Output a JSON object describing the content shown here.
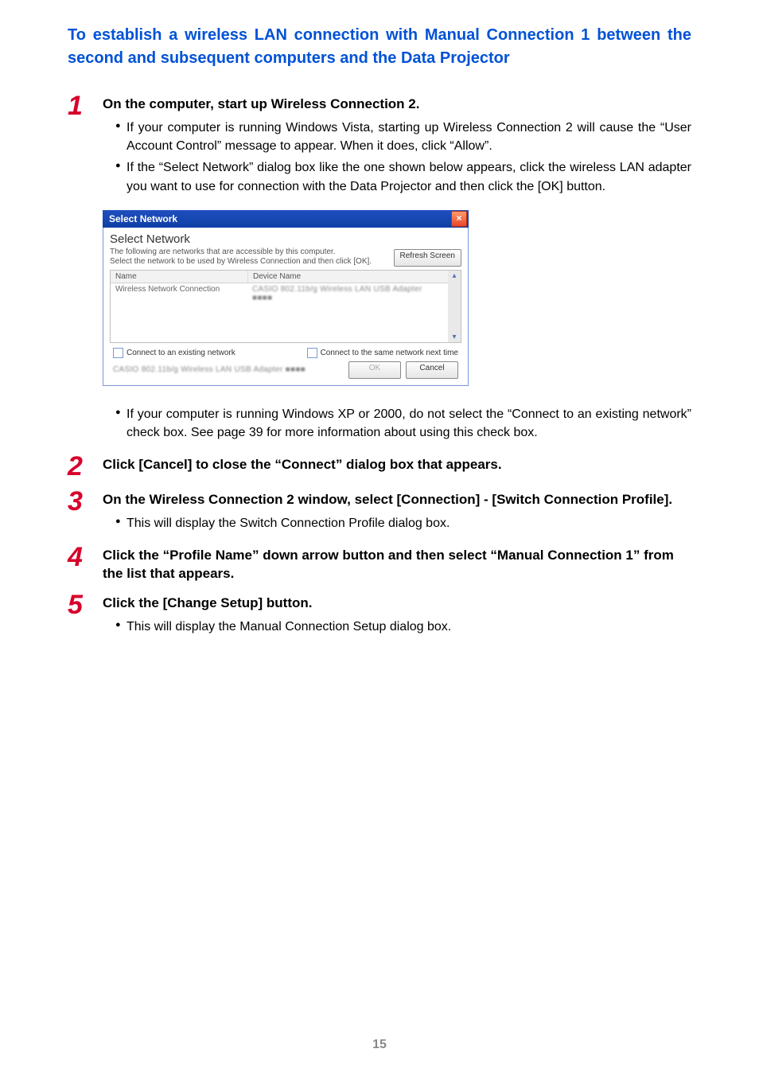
{
  "heading": "To establish a wireless LAN connection with Manual Connection 1 between the second and subsequent computers and the Data Projector",
  "steps": [
    {
      "num": "1",
      "title": "On the computer, start up Wireless Connection 2.",
      "bullets": [
        "If your computer is running Windows Vista, starting up Wireless Connection 2 will cause the “User Account Control” message to appear. When it does, click “Allow”.",
        "If the “Select Network” dialog box like the one shown below appears, click the wireless LAN adapter you want to use for connection with the Data Projector and then click the [OK] button."
      ],
      "after_bullets": [
        "If your computer is running Windows XP or 2000, do not select the “Connect to an existing network” check box. See page 39 for more information about using this check box."
      ]
    },
    {
      "num": "2",
      "title": "Click [Cancel] to close the “Connect” dialog box that appears.",
      "bullets": []
    },
    {
      "num": "3",
      "title": "On the Wireless Connection 2 window, select [Connection] - [Switch Connection Profile].",
      "bullets": [
        "This will display the Switch Connection Profile dialog box."
      ]
    },
    {
      "num": "4",
      "title": "Click the “Profile Name” down arrow button and then select “Manual Connection 1” from the list that appears.",
      "bullets": []
    },
    {
      "num": "5",
      "title": "Click the [Change Setup] button.",
      "bullets": [
        "This will display the Manual Connection Setup dialog box."
      ]
    }
  ],
  "dialog": {
    "titlebar": "Select Network",
    "close": "×",
    "heading": "Select Network",
    "line1": "The following are networks that are accessible by this computer.",
    "line2": "Select the network to be used by Wireless Connection and then click [OK].",
    "refresh": "Refresh Screen",
    "col_name": "Name",
    "col_device": "Device Name",
    "row_name": "Wireless Network Connection",
    "row_device_blur": "CASIO 802.11b/g Wireless LAN USB Adapter ■■■■",
    "chk1": "Connect to an existing network",
    "chk2": "Connect to the same network next time",
    "bottom_blur": "CASIO 802.11b/g Wireless LAN USB Adapter ■■■■",
    "ok": "OK",
    "cancel": "Cancel"
  },
  "page_number": "15"
}
